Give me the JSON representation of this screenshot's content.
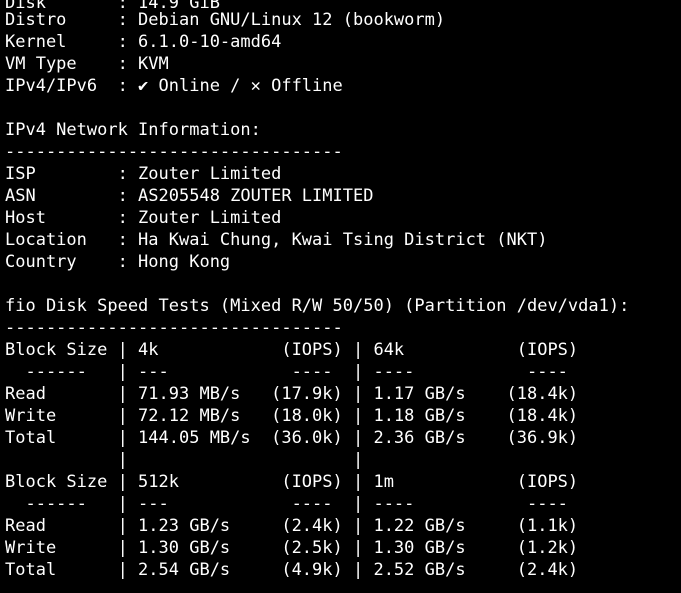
{
  "terminal": {
    "lines": [
      "Disk       : 14.9 GiB",
      "Distro     : Debian GNU/Linux 12 (bookworm)",
      "Kernel     : 6.1.0-10-amd64",
      "VM Type    : KVM",
      "IPv4/IPv6  : ✔ Online / ✕ Offline",
      "",
      "IPv4 Network Information:",
      "---------------------------------",
      "ISP        : Zouter Limited",
      "ASN        : AS205548 ZOUTER LIMITED",
      "Host       : Zouter Limited",
      "Location   : Ha Kwai Chung, Kwai Tsing District (NKT)",
      "Country    : Hong Kong",
      "",
      "fio Disk Speed Tests (Mixed R/W 50/50) (Partition /dev/vda1):",
      "---------------------------------",
      "Block Size | 4k            (IOPS) | 64k           (IOPS)",
      "  ------   | ---            ----  | ----           ----",
      "Read       | 71.93 MB/s   (17.9k) | 1.17 GB/s    (18.4k)",
      "Write      | 72.12 MB/s   (18.0k) | 1.18 GB/s    (18.4k)",
      "Total      | 144.05 MB/s  (36.0k) | 2.36 GB/s    (36.9k)",
      "           |                      |",
      "Block Size | 512k          (IOPS) | 1m            (IOPS)",
      "  ------   | ---            ----  | ----           ----",
      "Read       | 1.23 GB/s     (2.4k) | 1.22 GB/s     (1.1k)",
      "Write      | 1.30 GB/s     (2.5k) | 1.30 GB/s     (1.2k)",
      "Total      | 2.54 GB/s     (4.9k) | 2.52 GB/s     (2.4k)"
    ]
  }
}
